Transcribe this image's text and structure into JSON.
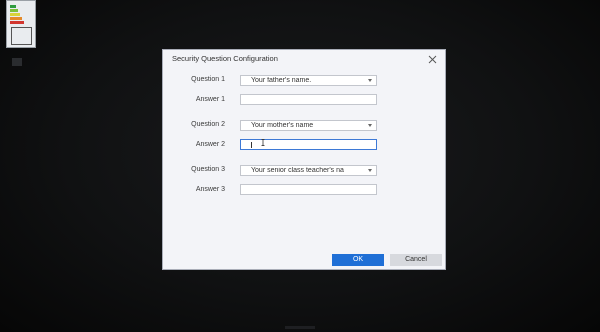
{
  "dialog": {
    "title": "Security Question Configuration",
    "close_icon": "close-icon"
  },
  "form": {
    "rows": [
      {
        "question_label": "Question 1",
        "question_value": "Your father's name.",
        "answer_label": "Answer 1",
        "answer_value": ""
      },
      {
        "question_label": "Question 2",
        "question_value": "Your mother's name",
        "answer_label": "Answer 2",
        "answer_value": ""
      },
      {
        "question_label": "Question 3",
        "question_value": "Your senior class teacher's na",
        "answer_label": "Answer 3",
        "answer_value": ""
      }
    ]
  },
  "buttons": {
    "ok_label": "OK",
    "cancel_label": "Cancel"
  },
  "colors": {
    "accent": "#1f6fd6",
    "dialog_bg": "#f3f4f8",
    "focus_border": "#3d79d6"
  }
}
